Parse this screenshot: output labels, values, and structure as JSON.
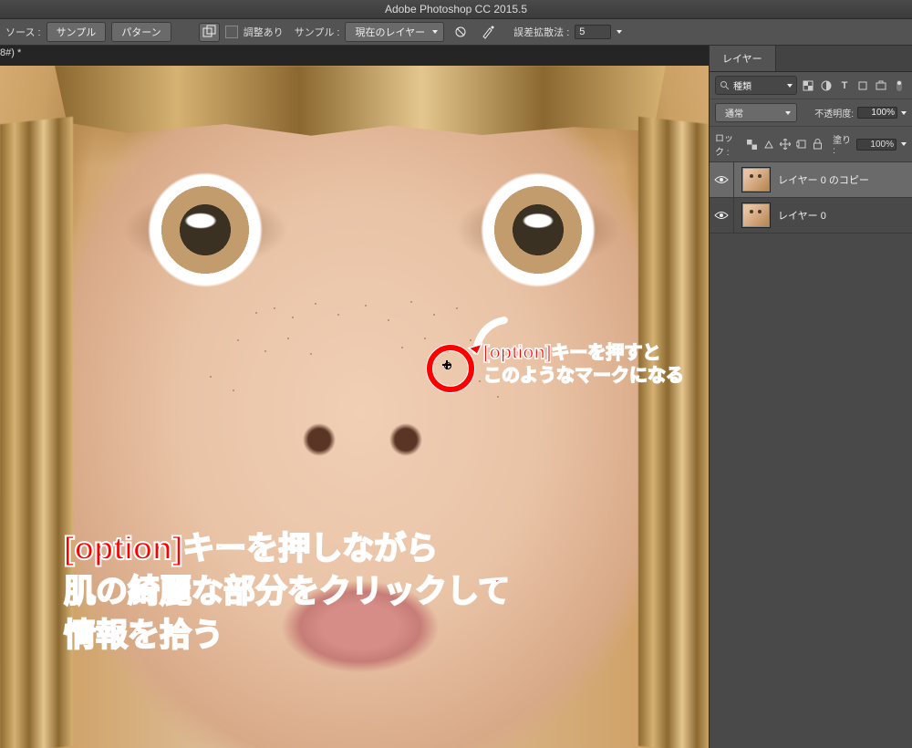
{
  "app_title": "Adobe Photoshop CC 2015.5",
  "document_tab": "8#) *",
  "optionsbar": {
    "source_label": "ソース :",
    "btn_sample": "サンプル",
    "btn_pattern": "パターン",
    "aligned_label": "調整あり",
    "sample_label": "サンプル :",
    "sample_value": "現在のレイヤー",
    "diffusion_label": "誤差拡散法 :",
    "diffusion_value": "5"
  },
  "annotation": {
    "small_l1": "[option]キーを押すと",
    "small_l2": "このようなマークになる",
    "big_l1": "[option]キーを押しながら",
    "big_l2": "肌の綺麗な部分をクリックして",
    "big_l3": "情報を拾う"
  },
  "layers_panel": {
    "tab": "レイヤー",
    "filter_value": "種類",
    "blend_mode": "通常",
    "opacity_label": "不透明度:",
    "opacity_value": "100%",
    "lock_label": "ロック :",
    "fill_label": "塗り :",
    "fill_value": "100%",
    "layers": [
      {
        "name": "レイヤー 0 のコピー",
        "selected": true
      },
      {
        "name": "レイヤー 0",
        "selected": false
      }
    ]
  }
}
